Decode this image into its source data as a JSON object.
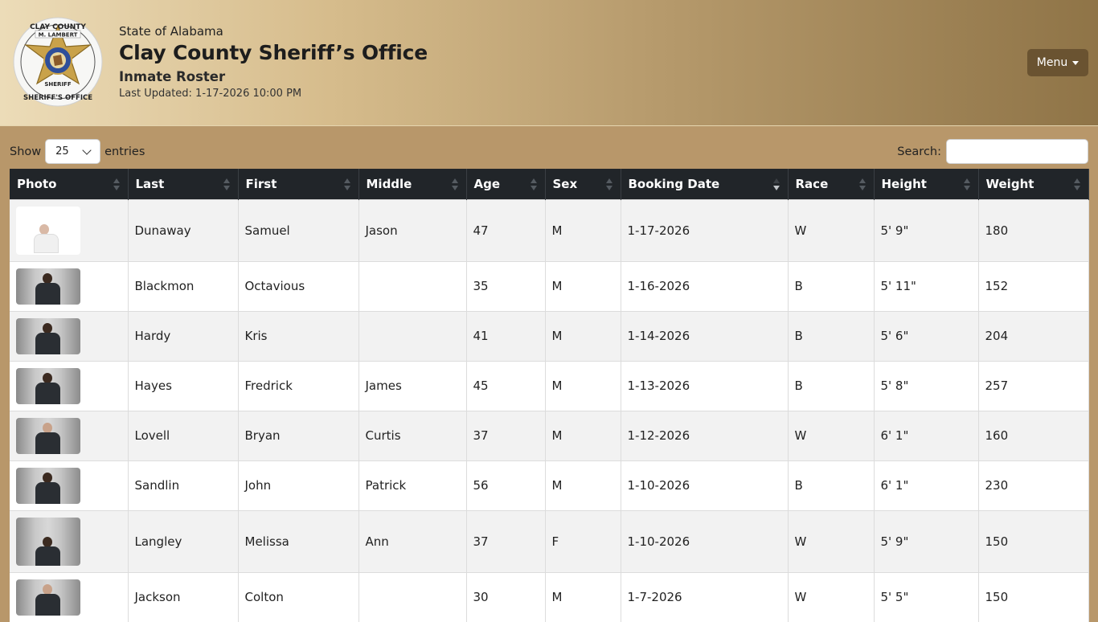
{
  "header": {
    "state": "State of Alabama",
    "office": "Clay County Sheriff’s Office",
    "subtitle": "Inmate Roster",
    "last_updated": "Last Updated: 1-17-2026 10:00 PM",
    "menu_label": "Menu",
    "badge_text": {
      "top": "CLAY COUNTY",
      "name": "M. LAMBERT",
      "middle": "SHERIFF",
      "bottom": "SHERIFF'S OFFICE"
    }
  },
  "controls": {
    "show_label": "Show",
    "entries_value": "25",
    "entries_label": "entries",
    "search_label": "Search:",
    "search_value": ""
  },
  "table": {
    "columns": [
      "Photo",
      "Last",
      "First",
      "Middle",
      "Age",
      "Sex",
      "Booking Date",
      "Race",
      "Height",
      "Weight"
    ],
    "rows": [
      {
        "last": "Dunaway",
        "first": "Samuel",
        "middle": "Jason",
        "age": "47",
        "sex": "M",
        "booking": "1-17-2026",
        "race": "W",
        "height": "5' 9\"",
        "weight": "180"
      },
      {
        "last": "Blackmon",
        "first": "Octavious",
        "middle": "",
        "age": "35",
        "sex": "M",
        "booking": "1-16-2026",
        "race": "B",
        "height": "5' 11\"",
        "weight": "152"
      },
      {
        "last": "Hardy",
        "first": "Kris",
        "middle": "",
        "age": "41",
        "sex": "M",
        "booking": "1-14-2026",
        "race": "B",
        "height": "5' 6\"",
        "weight": "204"
      },
      {
        "last": "Hayes",
        "first": "Fredrick",
        "middle": "James",
        "age": "45",
        "sex": "M",
        "booking": "1-13-2026",
        "race": "B",
        "height": "5' 8\"",
        "weight": "257"
      },
      {
        "last": "Lovell",
        "first": "Bryan",
        "middle": "Curtis",
        "age": "37",
        "sex": "M",
        "booking": "1-12-2026",
        "race": "W",
        "height": "6' 1\"",
        "weight": "160"
      },
      {
        "last": "Sandlin",
        "first": "John",
        "middle": "Patrick",
        "age": "56",
        "sex": "M",
        "booking": "1-10-2026",
        "race": "B",
        "height": "6' 1\"",
        "weight": "230"
      },
      {
        "last": "Langley",
        "first": "Melissa",
        "middle": "Ann",
        "age": "37",
        "sex": "F",
        "booking": "1-10-2026",
        "race": "W",
        "height": "5' 9\"",
        "weight": "150"
      },
      {
        "last": "Jackson",
        "first": "Colton",
        "middle": "",
        "age": "30",
        "sex": "M",
        "booking": "1-7-2026",
        "race": "W",
        "height": "5' 5\"",
        "weight": "150"
      }
    ]
  },
  "colors": {
    "header_dark": "#212529",
    "menu_button": "#6a5331",
    "page_background": "#b8976a"
  }
}
